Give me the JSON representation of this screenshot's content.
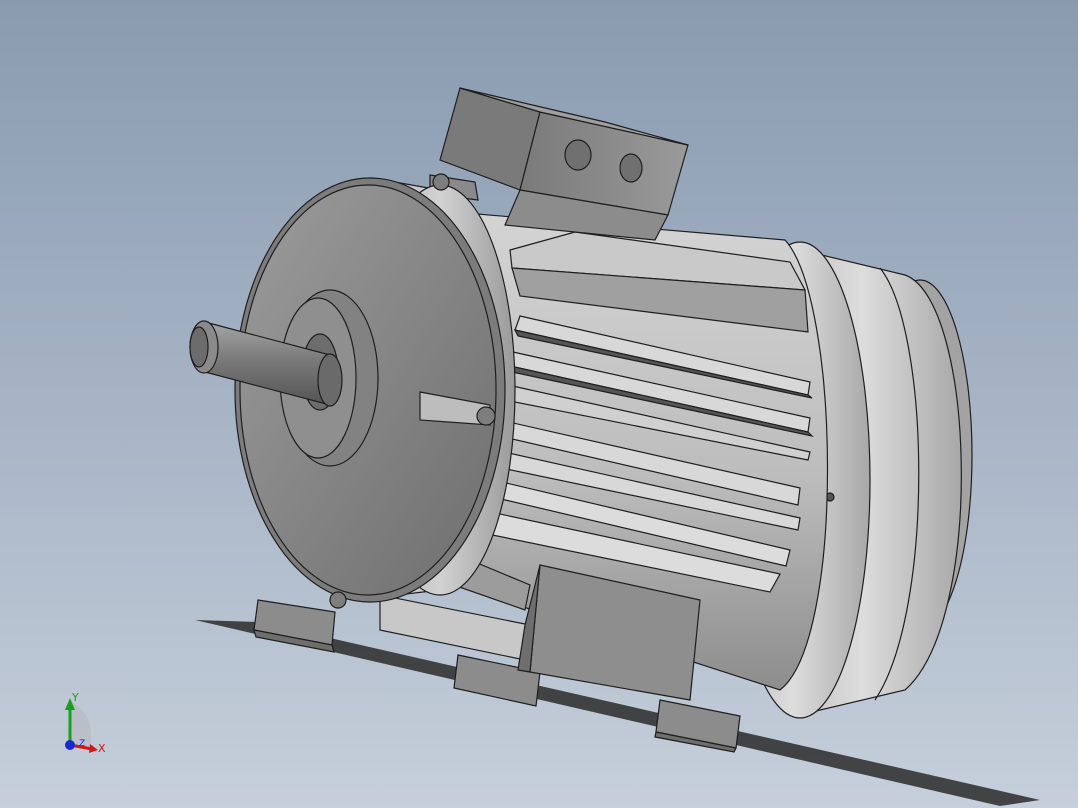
{
  "viewport": {
    "background_top": "#8a9bb0",
    "background_bottom": "#c6cfdb"
  },
  "model": {
    "icon": "electric-motor-icon",
    "body_color": "#a9a9a9",
    "edge_color": "#1e1e1e"
  },
  "triad": {
    "icon": "view-orientation-triad-icon",
    "x_label": "X",
    "y_label": "Y",
    "z_label": "Z",
    "colors": {
      "x": "#d01818",
      "y": "#19a019",
      "z": "#1a2ad0"
    }
  }
}
